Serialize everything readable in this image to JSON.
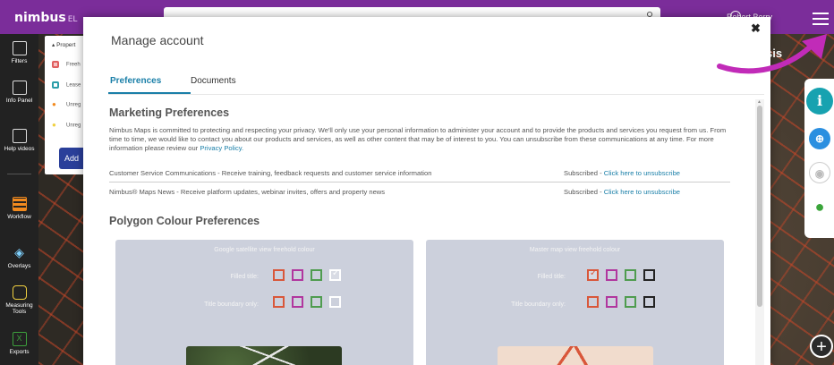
{
  "app": {
    "logo": "nimbus",
    "logo_sub": "EL",
    "user_name": "Robert Berry",
    "map_title_partial": "sis"
  },
  "leftnav": {
    "items": [
      {
        "label": "Filters",
        "icon": "filters-icon"
      },
      {
        "label": "Info Panel",
        "icon": "info-panel-icon"
      },
      {
        "label": "Help videos",
        "icon": "help-videos-icon"
      },
      {
        "label": "Workflow",
        "icon": "workflow-icon"
      },
      {
        "label": "Overlays",
        "icon": "overlays-icon"
      },
      {
        "label": "Measuring Tools",
        "icon": "measuring-tools-icon"
      },
      {
        "label": "Exports",
        "icon": "exports-icon"
      }
    ]
  },
  "properties_panel": {
    "header": "Propert",
    "rows": [
      {
        "label": "Freeh",
        "color": "#e06060"
      },
      {
        "label": "Lease",
        "color": "#2a9da8"
      },
      {
        "label": "Unreg",
        "color": "#f28a1e"
      },
      {
        "label": "Unreg",
        "color": "#f0d040"
      }
    ],
    "add_label": "Add"
  },
  "modal": {
    "title": "Manage account",
    "close_glyph": "✖",
    "tabs": [
      {
        "label": "Preferences",
        "active": true
      },
      {
        "label": "Documents",
        "active": false
      }
    ],
    "marketing": {
      "heading": "Marketing Preferences",
      "intro": "Nimbus Maps is committed to protecting and respecting your privacy. We'll only use your personal information to administer your account and to provide the products and services you request from us. From time to time, we would like to contact you about our products and services, as well as other content that may be of interest to you. You can unsubscribe from these communications at any time. For more information please review our ",
      "privacy_link": "Privacy Policy.",
      "rows": [
        {
          "label": "Customer Service Communications - Receive training, feedback requests and customer service information",
          "status": "Subscribed - ",
          "action": "Click here to unsubscribe"
        },
        {
          "label": "Nimbus® Maps News - Receive platform updates, webinar invites, offers and property news",
          "status": "Subscribed - ",
          "action": "Click here to unsubscribe"
        }
      ]
    },
    "polygon": {
      "heading": "Polygon Colour Preferences",
      "cards": [
        {
          "title": "Google satellite view freehold colour",
          "filled_label": "Filled title:",
          "boundary_label": "Title boundary only:",
          "filled_colors": [
            "#d9573a",
            "#b1369e",
            "#4f9c4f",
            "#ffffff"
          ],
          "filled_selected": 3,
          "boundary_colors": [
            "#d9573a",
            "#b1369e",
            "#4f9c4f",
            "#ffffff"
          ]
        },
        {
          "title": "Master map view freehold colour",
          "filled_label": "Filled title:",
          "boundary_label": "Title boundary only:",
          "filled_colors": [
            "#d9573a",
            "#b1369e",
            "#4f9c4f",
            "#222222"
          ],
          "filled_selected": 0,
          "boundary_colors": [
            "#d9573a",
            "#b1369e",
            "#4f9c4f",
            "#222222"
          ]
        }
      ]
    }
  },
  "colors": {
    "brand_purple": "#7b2d9a",
    "accent_blue": "#1a7fa8",
    "arrow_magenta": "#c12bb8"
  }
}
